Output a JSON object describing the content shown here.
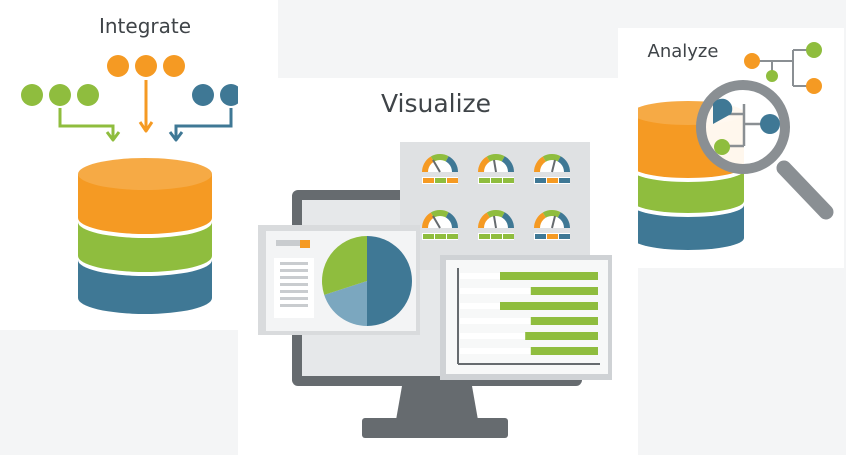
{
  "panels": {
    "integrate": {
      "title": "Integrate"
    },
    "visualize": {
      "title": "Visualize"
    },
    "analyze": {
      "title": "Analyze"
    }
  },
  "colors": {
    "orange": "#f59a23",
    "green": "#8fbd3e",
    "blue": "#3f7895",
    "light_blue": "#7ba7bf",
    "gray_dark": "#666b6f",
    "gray": "#8a8f93",
    "gray_light": "#c9cccf",
    "panel_bg": "#ffffff",
    "page_bg": "#f4f5f6"
  },
  "icons": [
    "database-icon",
    "monitor-icon",
    "pie-chart-icon",
    "gauge-icon",
    "bar-chart-icon",
    "magnifier-icon",
    "tree-icon"
  ],
  "chart_data": [
    {
      "type": "pie",
      "slices": [
        {
          "value": 0.5,
          "color": "#3f7895"
        },
        {
          "value": 0.2,
          "color": "#7ba7bf"
        },
        {
          "value": 0.3,
          "color": "#8fbd3e"
        }
      ]
    },
    {
      "type": "bar",
      "orientation": "horizontal",
      "series": [
        {
          "values": [
            0.7,
            0.48,
            0.7,
            0.48,
            0.52,
            0.48
          ],
          "color": "#8fbd3e"
        }
      ]
    }
  ]
}
